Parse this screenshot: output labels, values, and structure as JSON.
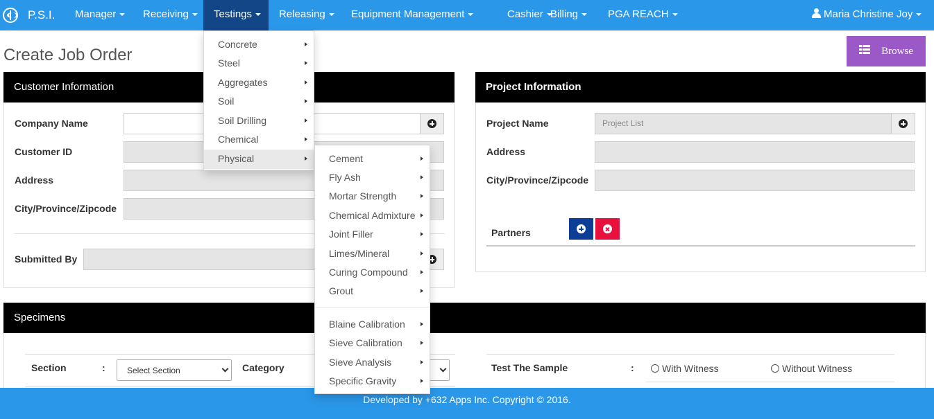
{
  "navbar": {
    "brand": "P.S.I.",
    "items": [
      {
        "label": "Manager"
      },
      {
        "label": "Receiving"
      },
      {
        "label": "Testings"
      },
      {
        "label": "Releasing"
      },
      {
        "label": "Equipment Management"
      },
      {
        "label": "Cashier"
      },
      {
        "label": "Billing"
      },
      {
        "label": "PGA REACH"
      }
    ],
    "user": "Maria Christine Joy"
  },
  "page": {
    "title": "Create Job Order",
    "browse_label": "Browse"
  },
  "customer": {
    "header": "Customer Information",
    "company_name_label": "Company Name",
    "customer_id_label": "Customer ID",
    "address_label": "Address",
    "city_label": "City/Province/Zipcode",
    "submitted_by_label": "Submitted By"
  },
  "project": {
    "header": "Project Information",
    "project_name_label": "Project Name",
    "project_name_placeholder": "Project List",
    "address_label": "Address",
    "city_label": "City/Province/Zipcode",
    "partners_label": "Partners"
  },
  "specimens": {
    "header": "Specimens",
    "section_label": "Section",
    "colon": ":",
    "section_select": "Select Section",
    "category_label": "Category",
    "test_sample_label": "Test The Sample",
    "with_witness": "With Witness",
    "without_witness": "Without Witness"
  },
  "testings_menu": {
    "items": [
      "Concrete",
      "Steel",
      "Aggregates",
      "Soil",
      "Soil Drilling",
      "Chemical",
      "Physical"
    ]
  },
  "physical_menu": {
    "group1": [
      "Cement",
      "Fly Ash",
      "Mortar Strength",
      "Chemical Admixture",
      "Joint Filler",
      "Limes/Mineral",
      "Curing Compound",
      "Grout"
    ],
    "group2": [
      "Blaine Calibration",
      "Sieve Calibration",
      "Sieve Analysis",
      "Specific Gravity"
    ]
  },
  "footer": {
    "text": "Developed by +632 Apps Inc. Copyright © 2016."
  },
  "colors": {
    "navbar": "#2b97e9",
    "nav_active": "#124686",
    "browse": "#9b59c7",
    "partner_add": "#0d3e96",
    "partner_remove": "#e8113d"
  }
}
